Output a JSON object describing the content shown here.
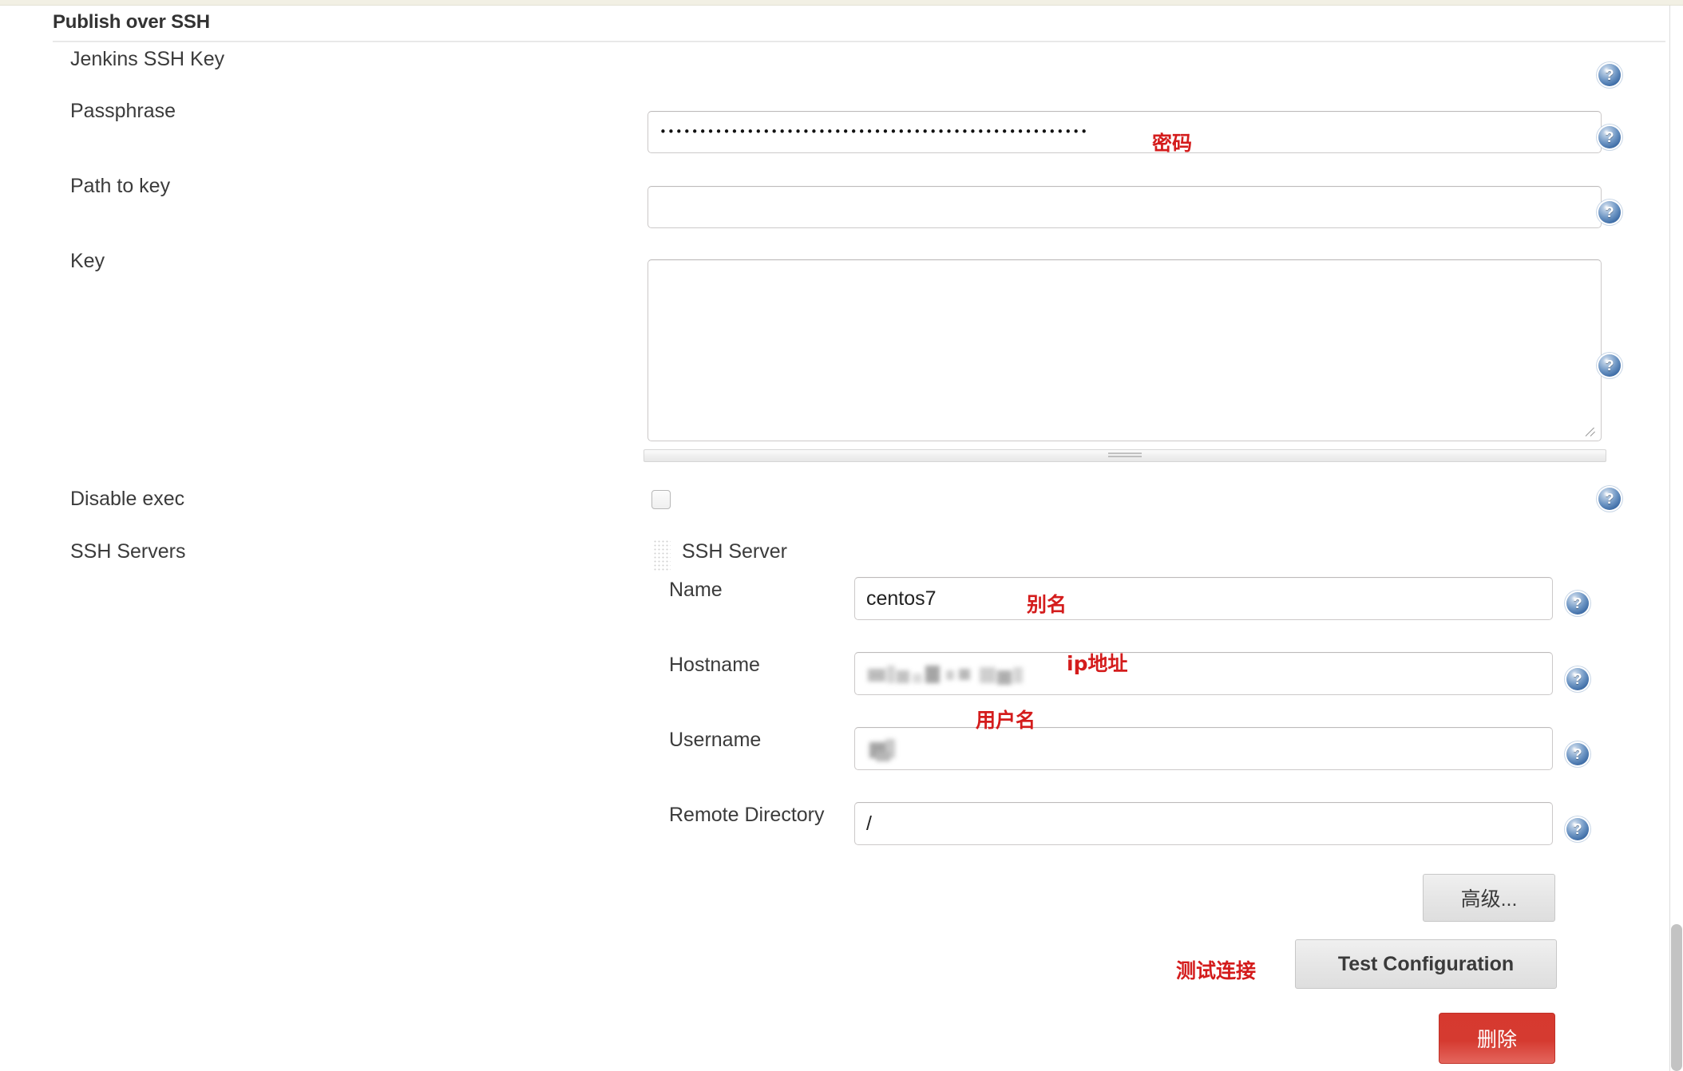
{
  "section": {
    "title": "Publish over SSH"
  },
  "fields": {
    "jenkins_ssh_key": {
      "label": "Jenkins SSH Key"
    },
    "passphrase": {
      "label": "Passphrase",
      "value_mask": "••••••••••••••••••••••••••••••••••••••••••••••••••••••",
      "annotation": "密码"
    },
    "path_to_key": {
      "label": "Path to key",
      "value": "",
      "placeholder": ""
    },
    "key": {
      "label": "Key",
      "value": "",
      "placeholder": ""
    },
    "disable_exec": {
      "label": "Disable exec",
      "checked": false
    },
    "ssh_servers": {
      "label": "SSH Servers"
    }
  },
  "ssh_server": {
    "title": "SSH Server",
    "drag_handle_icon": "drag-dots-icon",
    "name": {
      "label": "Name",
      "value": "centos7",
      "annotation": "别名"
    },
    "hostname": {
      "label": "Hostname",
      "value": "",
      "redacted": true,
      "annotation": "ip地址"
    },
    "username": {
      "label": "Username",
      "value": "",
      "redacted": true,
      "annotation": "用户名"
    },
    "remote_directory": {
      "label": "Remote Directory",
      "value": "/"
    }
  },
  "buttons": {
    "advanced": "高级...",
    "test_configuration": "Test Configuration",
    "test_configuration_annotation": "测试连接",
    "delete": "删除"
  },
  "icons": {
    "help": "?",
    "help_name": "help-icon"
  },
  "colors": {
    "annotation_red": "#d41c1c",
    "delete_button": "#d6392f",
    "help_icon_blue": "#3b6aa4",
    "top_strip": "#f2f0e4"
  }
}
